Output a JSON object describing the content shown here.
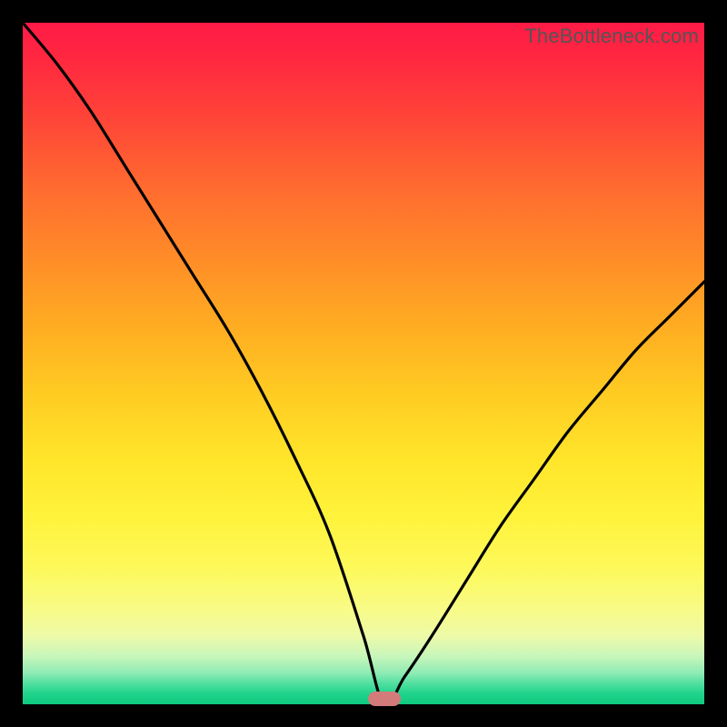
{
  "watermark": "TheBottleneck.com",
  "colors": {
    "frame": "#000000",
    "curve": "#000000",
    "marker": "#d37a7a"
  },
  "chart_data": {
    "type": "line",
    "title": "",
    "xlabel": "",
    "ylabel": "",
    "xlim": [
      0,
      100
    ],
    "ylim": [
      0,
      100
    ],
    "grid": false,
    "legend": false,
    "annotations": [
      {
        "type": "marker",
        "x": 53,
        "y": 0,
        "shape": "pill"
      }
    ],
    "background_gradient": {
      "direction": "vertical",
      "stops": [
        {
          "pos": 0,
          "color": "#ff1a46"
        },
        {
          "pos": 50,
          "color": "#ffca22"
        },
        {
          "pos": 85,
          "color": "#f8fb86"
        },
        {
          "pos": 100,
          "color": "#10c97f"
        }
      ]
    },
    "series": [
      {
        "name": "bottleneck-curve",
        "x": [
          0,
          5,
          10,
          15,
          20,
          25,
          30,
          35,
          40,
          45,
          50,
          53,
          56,
          60,
          65,
          70,
          75,
          80,
          85,
          90,
          95,
          100
        ],
        "y": [
          100,
          94,
          87,
          79,
          71,
          63,
          55,
          46,
          36,
          25,
          10,
          0,
          4,
          10,
          18,
          26,
          33,
          40,
          46,
          52,
          57,
          62
        ]
      }
    ]
  }
}
